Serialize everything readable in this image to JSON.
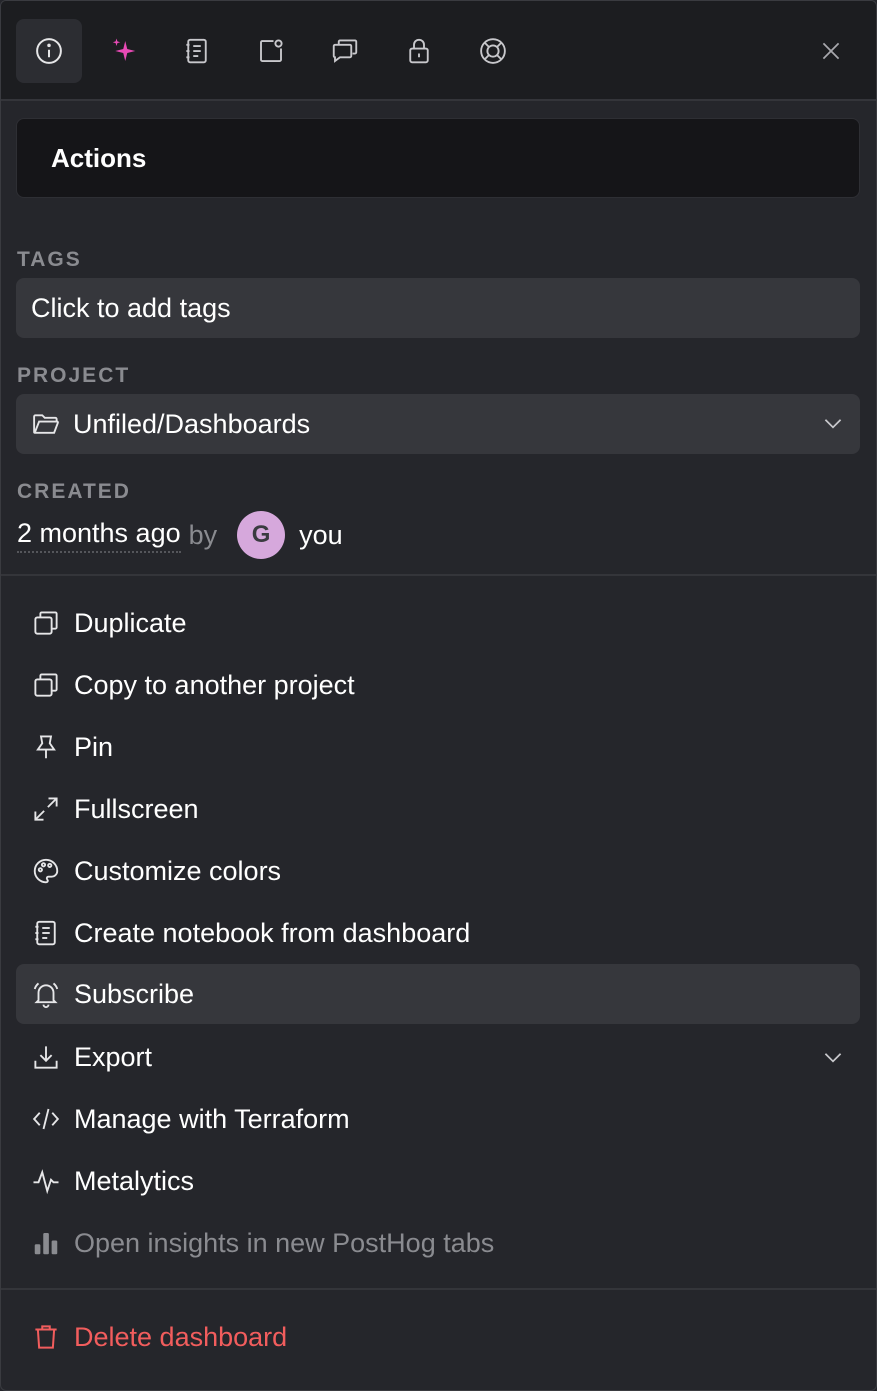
{
  "toolbar": {
    "buttons": [
      {
        "icon": "info-icon",
        "active": true
      },
      {
        "icon": "sparkles-icon",
        "active": false,
        "color": "#e84ab5"
      },
      {
        "icon": "notebook-icon",
        "active": false
      },
      {
        "icon": "notification-icon",
        "active": false
      },
      {
        "icon": "discussion-icon",
        "active": false
      },
      {
        "icon": "lock-icon",
        "active": false
      },
      {
        "icon": "support-icon",
        "active": false
      }
    ],
    "close_icon": "close-icon"
  },
  "panel": {
    "title": "Actions"
  },
  "tags": {
    "label": "TAGS",
    "placeholder": "Click to add tags"
  },
  "project": {
    "label": "PROJECT",
    "value": "Unfiled/Dashboards"
  },
  "created": {
    "label": "CREATED",
    "time": "2 months ago",
    "by": "by",
    "avatar_initial": "G",
    "user": "you"
  },
  "menu": {
    "items": [
      {
        "label": "Duplicate",
        "icon": "duplicate-icon"
      },
      {
        "label": "Copy to another project",
        "icon": "copy-icon"
      },
      {
        "label": "Pin",
        "icon": "pin-icon"
      },
      {
        "label": "Fullscreen",
        "icon": "fullscreen-icon"
      },
      {
        "label": "Customize colors",
        "icon": "palette-icon"
      },
      {
        "label": "Create notebook from dashboard",
        "icon": "notebook-icon"
      },
      {
        "label": "Subscribe",
        "icon": "bell-icon"
      },
      {
        "label": "Export",
        "icon": "download-icon"
      },
      {
        "label": "Manage with Terraform",
        "icon": "code-icon"
      },
      {
        "label": "Metalytics",
        "icon": "pulse-icon"
      },
      {
        "label": "Open insights in new PostHog tabs",
        "icon": "bar-chart-icon"
      }
    ],
    "delete_label": "Delete dashboard"
  },
  "colors": {
    "background": "#25262b",
    "toolbar": "#1c1d20",
    "field": "#36373c",
    "danger": "#f25d5d",
    "muted": "#8a8b90",
    "accent": "#e84ab5",
    "avatar": "#d6a8dc"
  }
}
